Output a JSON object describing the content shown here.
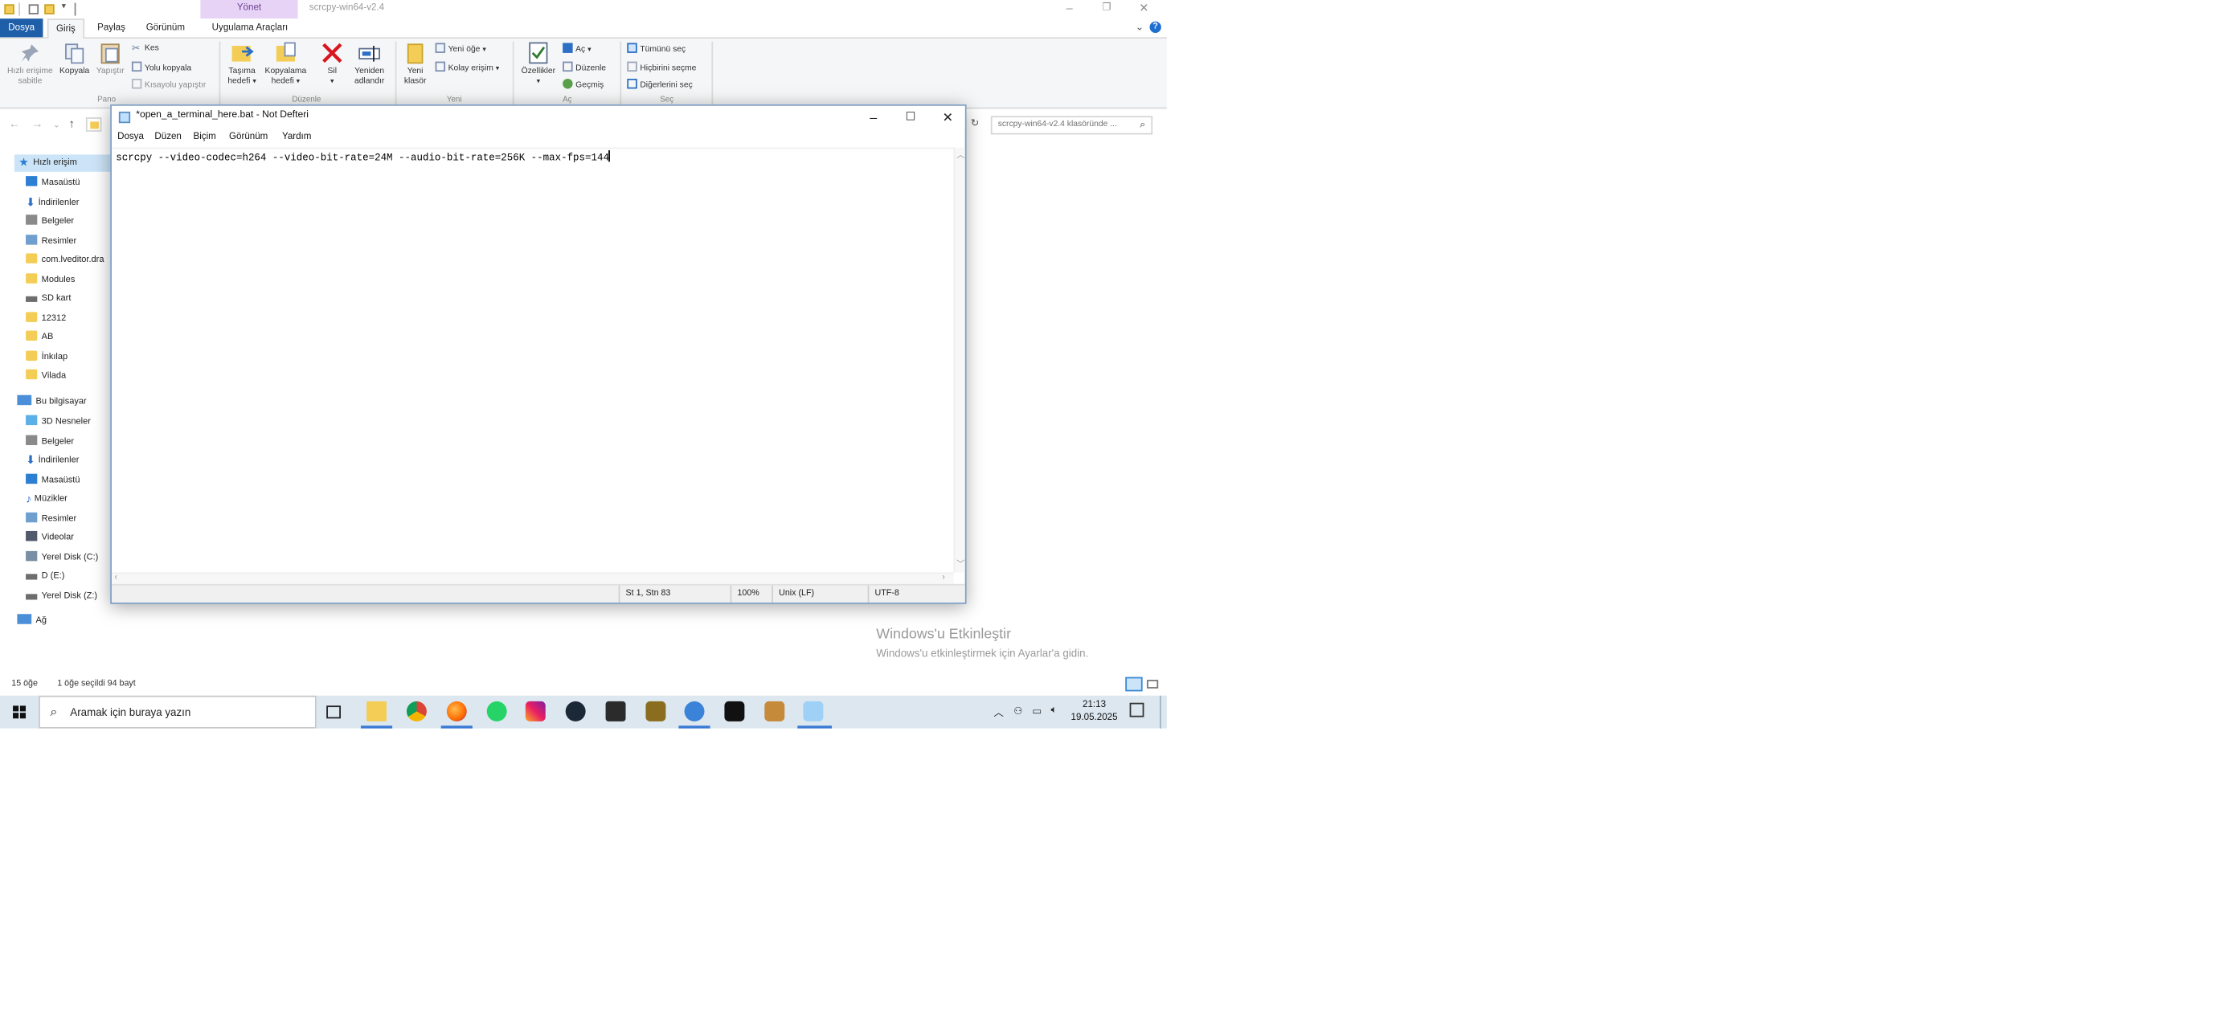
{
  "explorer": {
    "context_tab": "Yönet",
    "title": "scrcpy-win64-v2.4",
    "tabs": [
      "Dosya",
      "Giriş",
      "Paylaş",
      "Görünüm",
      "Uygulama Araçları"
    ],
    "ribbon": {
      "pano": {
        "pin_label": "Hızlı erişime sabitle",
        "copy_label": "Kopyala",
        "paste_label": "Yapıştır",
        "cut_label": "Kes",
        "copy_path_label": "Yolu kopyala",
        "paste_shortcut_label": "Kısayolu yapıştır",
        "group_label": "Pano"
      },
      "duzenle": {
        "move_to_label": "Taşıma hedefi",
        "copy_to_label": "Kopyalama hedefi",
        "delete_label": "Sil",
        "rename_label": "Yeniden adlandır",
        "group_label": "Düzenle"
      },
      "yeni": {
        "new_folder_label": "Yeni klasör",
        "new_item_label": "Yeni öğe",
        "easy_access_label": "Kolay erişim",
        "group_label": "Yeni"
      },
      "ac": {
        "properties_label": "Özellikler",
        "open_label": "Aç",
        "edit_label": "Düzenle",
        "history_label": "Geçmiş",
        "group_label": "Aç"
      },
      "sec": {
        "select_all_label": "Tümünü seç",
        "select_none_label": "Hiçbirini seçme",
        "invert_label": "Diğerlerini seç",
        "group_label": "Seç"
      }
    },
    "search_placeholder": "scrcpy-win64-v2.4 klasöründe ...",
    "nav": {
      "quick_access": "Hızlı erişim",
      "quick_items": [
        "Masaüstü",
        "İndirilenler",
        "Belgeler",
        "Resimler",
        "com.lveditor.dra",
        "Modules",
        "SD kart",
        "12312",
        "AB",
        "İnkılap",
        "Vilada"
      ],
      "this_pc": "Bu bilgisayar",
      "pc_items": [
        "3D Nesneler",
        "Belgeler",
        "İndirilenler",
        "Masaüstü",
        "Müzikler",
        "Resimler",
        "Videolar",
        "Yerel Disk (C:)",
        "D (E:)",
        "Yerel Disk (Z:)"
      ],
      "network": "Ağ"
    },
    "status": {
      "item_count": "15 öğe",
      "selection": "1 öğe seçildi  94 bayt"
    }
  },
  "watermark": {
    "line1": "Windows'u Etkinleştir",
    "line2": "Windows'u etkinleştirmek için Ayarlar'a gidin."
  },
  "notepad": {
    "title": "*open_a_terminal_here.bat - Not Defteri",
    "menu": [
      "Dosya",
      "Düzen",
      "Biçim",
      "Görünüm",
      "Yardım"
    ],
    "content": "scrcpy --video-codec=h264 --video-bit-rate=24M --audio-bit-rate=256K --max-fps=144",
    "status": {
      "position": "St 1, Stn 83",
      "zoom": "100%",
      "line_ending": "Unix (LF)",
      "encoding": "UTF-8"
    }
  },
  "taskbar": {
    "search_placeholder": "Aramak için buraya yazın",
    "time": "21:13",
    "date": "19.05.2025",
    "apps": [
      "task-view",
      "file-explorer",
      "chrome",
      "firefox",
      "whatsapp",
      "instagram",
      "steam",
      "app-shield",
      "app-game",
      "app-blue",
      "capcut",
      "app-photo",
      "notepad"
    ]
  },
  "colors": {
    "accent": "#1f5ea8",
    "context_tab": "#e6d3f6",
    "taskbar": "#dde7f0",
    "selection": "#cce4f7"
  }
}
